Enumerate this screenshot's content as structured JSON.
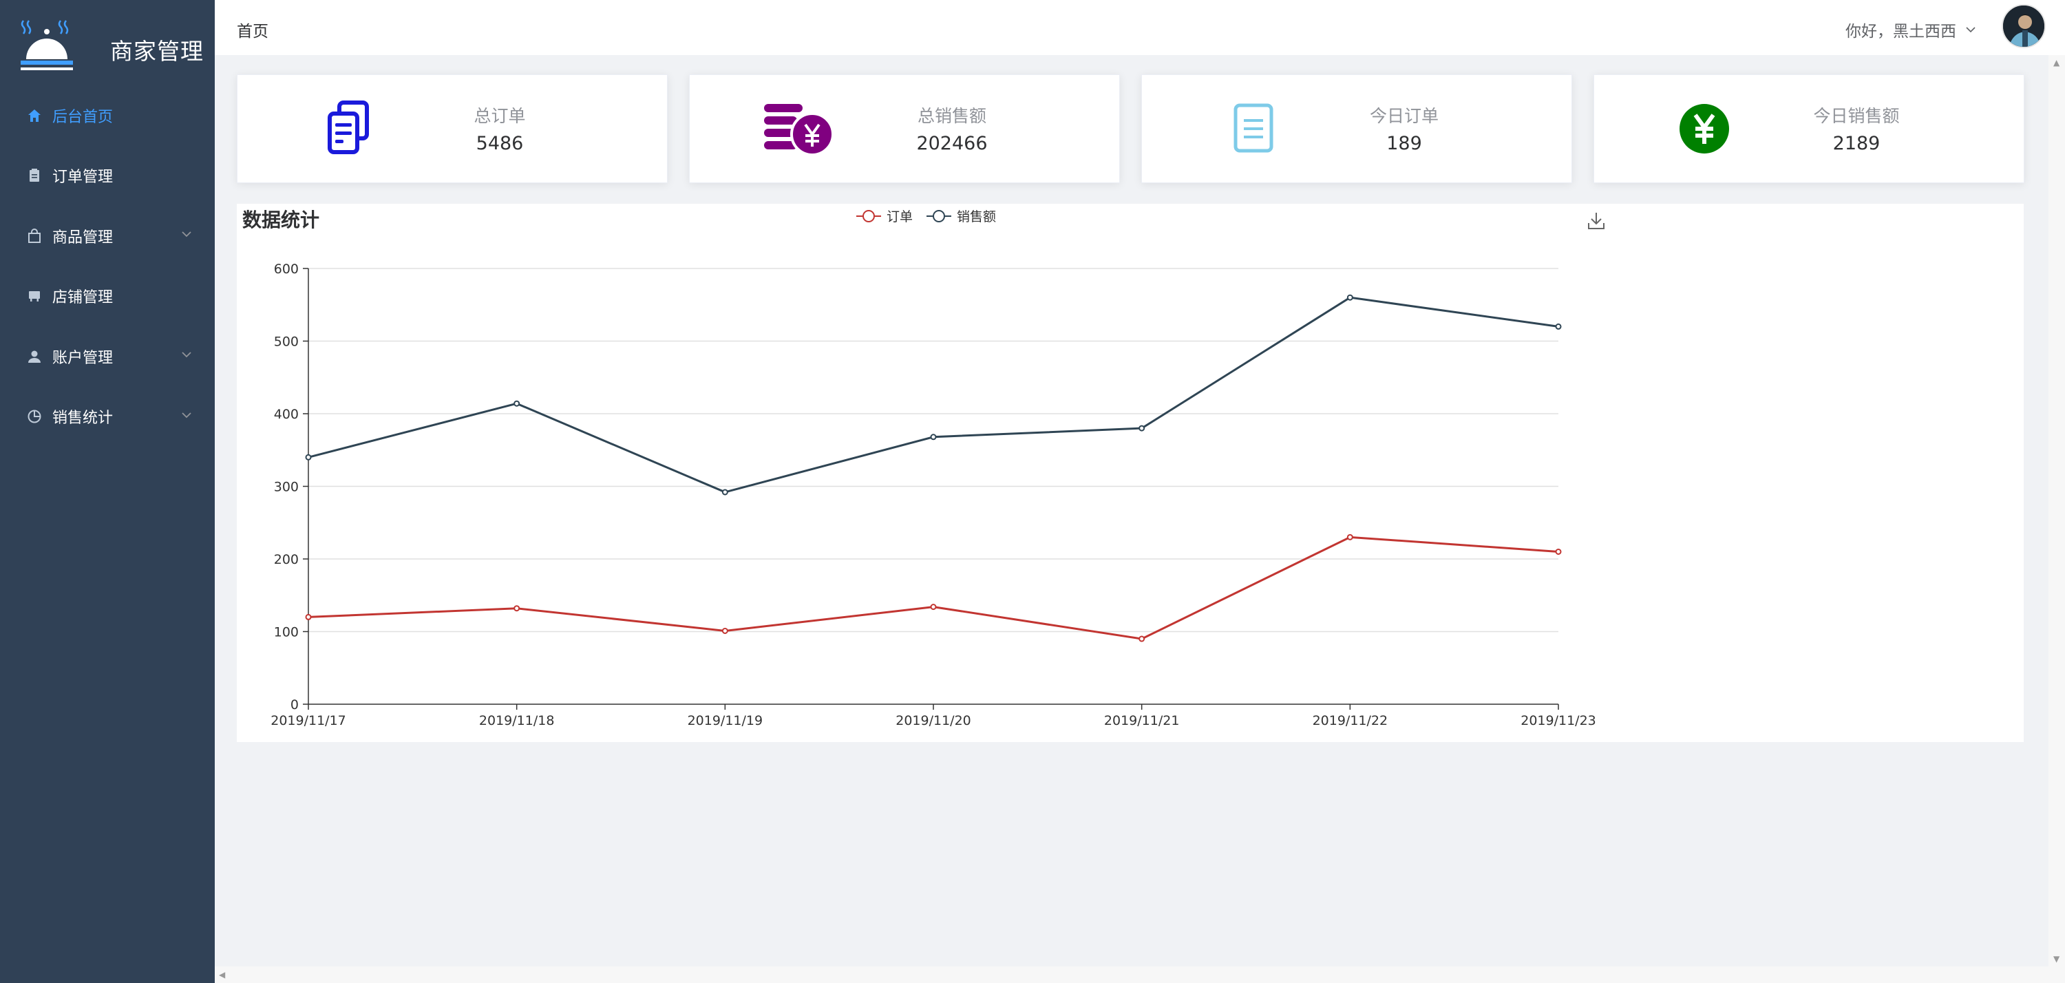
{
  "app": {
    "title": "商家管理"
  },
  "sidebar": {
    "items": [
      {
        "label": "后台首页",
        "icon": "home-icon",
        "active": true,
        "has_children": false
      },
      {
        "label": "订单管理",
        "icon": "clipboard-icon",
        "active": false,
        "has_children": false
      },
      {
        "label": "商品管理",
        "icon": "shopping-bag-icon",
        "active": false,
        "has_children": true
      },
      {
        "label": "店铺管理",
        "icon": "store-icon",
        "active": false,
        "has_children": false
      },
      {
        "label": "账户管理",
        "icon": "user-icon",
        "active": false,
        "has_children": true
      },
      {
        "label": "销售统计",
        "icon": "pie-chart-icon",
        "active": false,
        "has_children": true
      }
    ]
  },
  "header": {
    "breadcrumb": "首页",
    "greeting": "你好，黑土西西"
  },
  "stats": [
    {
      "title": "总订单",
      "value": "5486",
      "icon": "documents-icon",
      "color": "#1a1adb"
    },
    {
      "title": "总销售额",
      "value": "202466",
      "icon": "coins-yen-icon",
      "color": "#800080"
    },
    {
      "title": "今日订单",
      "value": "189",
      "icon": "document-icon",
      "color": "#7ecbe8"
    },
    {
      "title": "今日销售额",
      "value": "2189",
      "icon": "yen-circle-icon",
      "color": "#008000"
    }
  ],
  "chart_panel": {
    "title": "数据统计"
  },
  "chart_data": {
    "type": "line",
    "title": "",
    "categories": [
      "2019/11/17",
      "2019/11/18",
      "2019/11/19",
      "2019/11/20",
      "2019/11/21",
      "2019/11/22",
      "2019/11/23"
    ],
    "series": [
      {
        "name": "订单",
        "color": "#c23531",
        "values": [
          120,
          132,
          101,
          134,
          90,
          230,
          210
        ]
      },
      {
        "name": "销售额",
        "color": "#2f4554",
        "values": [
          340,
          414,
          292,
          368,
          380,
          560,
          520
        ]
      }
    ],
    "ylim": [
      0,
      600
    ],
    "yticks": [
      0,
      100,
      200,
      300,
      400,
      500,
      600
    ],
    "grid": true,
    "legend_position": "top-center"
  }
}
